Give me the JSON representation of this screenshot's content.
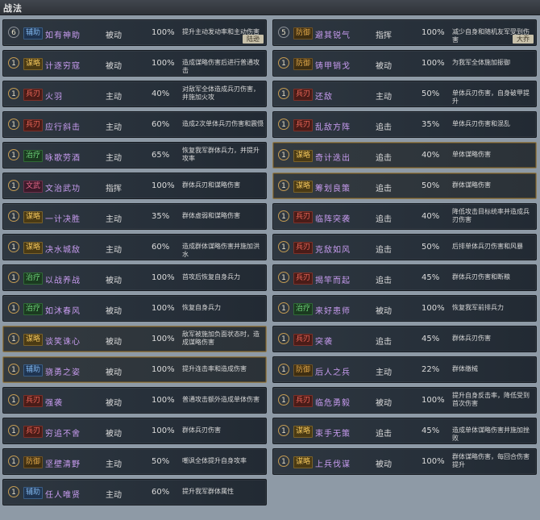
{
  "header": {
    "title": "战法"
  },
  "left": [
    {
      "level": "6",
      "tag": "辅助",
      "tagClass": "t-fz",
      "name": "如有神助",
      "type": "被动",
      "rate": "100%",
      "desc": "提升主动发动率和主动伤害",
      "badge": "陆逊",
      "selected": false
    },
    {
      "level": "1",
      "tag": "谋略",
      "tagClass": "t-mo",
      "name": "计逐穷寇",
      "type": "被动",
      "rate": "100%",
      "desc": "造成谋略伤害后进行普通攻击",
      "selected": false
    },
    {
      "level": "1",
      "tag": "兵刃",
      "tagClass": "t-bl",
      "name": "火羽",
      "type": "主动",
      "rate": "40%",
      "desc": "对敌军全体造成兵刃伤害，并施加火攻",
      "selected": false
    },
    {
      "level": "1",
      "tag": "兵刃",
      "tagClass": "t-bl",
      "name": "应行斜击",
      "type": "主动",
      "rate": "60%",
      "desc": "造成2次单体兵刃伤害和震慑",
      "selected": false
    },
    {
      "level": "1",
      "tag": "治疗",
      "tagClass": "t-zl",
      "name": "咏歌劳酒",
      "type": "主动",
      "rate": "65%",
      "desc": "恢复我军群体兵力，并提升攻率",
      "selected": false
    },
    {
      "level": "1",
      "tag": "文武",
      "tagClass": "t-wz",
      "name": "文治武功",
      "type": "指挥",
      "rate": "100%",
      "desc": "群体兵刃和谋略伤害",
      "selected": false
    },
    {
      "level": "1",
      "tag": "谋略",
      "tagClass": "t-mo",
      "name": "一计决胜",
      "type": "主动",
      "rate": "35%",
      "desc": "群体虚弱和谋略伤害",
      "selected": false
    },
    {
      "level": "1",
      "tag": "谋略",
      "tagClass": "t-mo",
      "name": "决水城敌",
      "type": "主动",
      "rate": "60%",
      "desc": "造成群体谋略伤害并施加洪水",
      "selected": false
    },
    {
      "level": "1",
      "tag": "治疗",
      "tagClass": "t-zl",
      "name": "以战养战",
      "type": "被动",
      "rate": "100%",
      "desc": "首攻后恢复自身兵力",
      "selected": false
    },
    {
      "level": "1",
      "tag": "治疗",
      "tagClass": "t-zl",
      "name": "如沐春风",
      "type": "被动",
      "rate": "100%",
      "desc": "恢复自身兵力",
      "selected": false
    },
    {
      "level": "1",
      "tag": "谋略",
      "tagClass": "t-mo",
      "name": "谈笑诛心",
      "type": "被动",
      "rate": "100%",
      "desc": "敌军被施加负面状态时，造成谋略伤害",
      "selected": true
    },
    {
      "level": "1",
      "tag": "辅助",
      "tagClass": "t-fz",
      "name": "骁勇之姿",
      "type": "被动",
      "rate": "100%",
      "desc": "提升连击率和造成伤害",
      "selected": true
    },
    {
      "level": "1",
      "tag": "兵刃",
      "tagClass": "t-bl",
      "name": "强袭",
      "type": "被动",
      "rate": "100%",
      "desc": "普通攻击额外造成单体伤害",
      "selected": false
    },
    {
      "level": "1",
      "tag": "兵刃",
      "tagClass": "t-bl",
      "name": "穷追不舍",
      "type": "被动",
      "rate": "100%",
      "desc": "群体兵刃伤害",
      "selected": false
    },
    {
      "level": "1",
      "tag": "防御",
      "tagClass": "t-fy",
      "name": "坚壁清野",
      "type": "主动",
      "rate": "50%",
      "desc": "嘲讽全体提升自身攻率",
      "selected": false
    },
    {
      "level": "1",
      "tag": "辅助",
      "tagClass": "t-fz",
      "name": "任人唯贤",
      "type": "主动",
      "rate": "60%",
      "desc": "提升我军群体属性",
      "selected": false
    }
  ],
  "right": [
    {
      "level": "5",
      "tag": "防御",
      "tagClass": "t-fy",
      "name": "避其锐气",
      "type": "指挥",
      "rate": "100%",
      "desc": "减少自身和随机友军受到伤害",
      "badge": "大乔",
      "selected": false
    },
    {
      "level": "1",
      "tag": "防御",
      "tagClass": "t-fy",
      "name": "铸甲销戈",
      "type": "被动",
      "rate": "100%",
      "desc": "为我军全体施加振御",
      "selected": false
    },
    {
      "level": "1",
      "tag": "兵刃",
      "tagClass": "t-bl",
      "name": "还敌",
      "type": "主动",
      "rate": "50%",
      "desc": "单体兵刃伤害，自身破甲提升",
      "selected": false
    },
    {
      "level": "1",
      "tag": "兵刃",
      "tagClass": "t-bl",
      "name": "乱敌方阵",
      "type": "追击",
      "rate": "35%",
      "desc": "单体兵刃伤害和混乱",
      "selected": false
    },
    {
      "level": "1",
      "tag": "谋略",
      "tagClass": "t-mo",
      "name": "奇计迭出",
      "type": "追击",
      "rate": "40%",
      "desc": "单体谋略伤害",
      "selected": true
    },
    {
      "level": "1",
      "tag": "谋略",
      "tagClass": "t-mo",
      "name": "筹划良策",
      "type": "追击",
      "rate": "50%",
      "desc": "群体谋略伤害",
      "selected": true
    },
    {
      "level": "1",
      "tag": "兵刃",
      "tagClass": "t-bl",
      "name": "临阵突袭",
      "type": "追击",
      "rate": "40%",
      "desc": "降低攻击目标统率并造成兵刃伤害",
      "selected": false
    },
    {
      "level": "1",
      "tag": "兵刃",
      "tagClass": "t-bl",
      "name": "克敌如风",
      "type": "追击",
      "rate": "50%",
      "desc": "后排单体兵刃伤害和风暴",
      "selected": false
    },
    {
      "level": "1",
      "tag": "兵刃",
      "tagClass": "t-bl",
      "name": "揭竿而起",
      "type": "追击",
      "rate": "45%",
      "desc": "群体兵刃伤害和断粮",
      "selected": false
    },
    {
      "level": "1",
      "tag": "治疗",
      "tagClass": "t-zl",
      "name": "来好患师",
      "type": "被动",
      "rate": "100%",
      "desc": "恢复我军前排兵力",
      "selected": false
    },
    {
      "level": "1",
      "tag": "兵刃",
      "tagClass": "t-bl",
      "name": "突袭",
      "type": "追击",
      "rate": "45%",
      "desc": "群体兵刃伤害",
      "selected": false
    },
    {
      "level": "1",
      "tag": "防御",
      "tagClass": "t-fy",
      "name": "后人之兵",
      "type": "主动",
      "rate": "22%",
      "desc": "群体缴械",
      "selected": false
    },
    {
      "level": "1",
      "tag": "兵刃",
      "tagClass": "t-bl",
      "name": "临危勇毅",
      "type": "被动",
      "rate": "100%",
      "desc": "提升自身反击率，降低受到首次伤害",
      "selected": false
    },
    {
      "level": "1",
      "tag": "谋略",
      "tagClass": "t-mo",
      "name": "束手无策",
      "type": "追击",
      "rate": "45%",
      "desc": "造成单体谋略伤害并施加挫败",
      "selected": false
    },
    {
      "level": "1",
      "tag": "谋略",
      "tagClass": "t-mo",
      "name": "上兵伐谋",
      "type": "被动",
      "rate": "100%",
      "desc": "群体谋略伤害，每回合伤害提升",
      "selected": false
    }
  ]
}
